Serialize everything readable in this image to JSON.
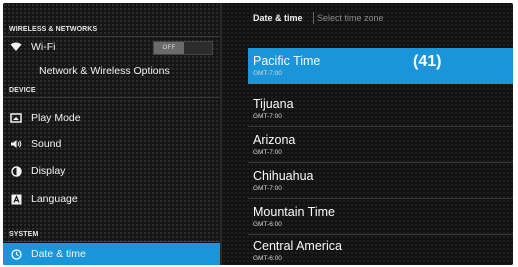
{
  "sidebar": {
    "sections": [
      "WIRELESS & NETWORKS",
      "DEVICE",
      "SYSTEM"
    ],
    "wifi": {
      "label": "Wi-Fi",
      "toggle": "OFF"
    },
    "network_options": "Network & Wireless Options",
    "items": {
      "play_mode": "Play Mode",
      "sound": "Sound",
      "display": "Display",
      "language": "Language",
      "date_time": "Date & time"
    }
  },
  "header": {
    "crumb": "Date & time",
    "subtitle": "Select time zone"
  },
  "timezones": [
    {
      "name": "Pacific Time",
      "offset": "GMT-7:00",
      "selected": true
    },
    {
      "name": "Tijuana",
      "offset": "GMT-7:00"
    },
    {
      "name": "Arizona",
      "offset": "GMT-7:00"
    },
    {
      "name": "Chihuahua",
      "offset": "GMT-7:00"
    },
    {
      "name": "Mountain Time",
      "offset": "GMT-6:00"
    },
    {
      "name": "Central America",
      "offset": "GMT-6:00"
    }
  ],
  "annotation": "(41)",
  "colors": {
    "accent": "#1b95d9"
  },
  "icons": [
    "wifi-icon",
    "play-mode-icon",
    "sound-icon",
    "display-icon",
    "language-icon",
    "clock-icon"
  ]
}
